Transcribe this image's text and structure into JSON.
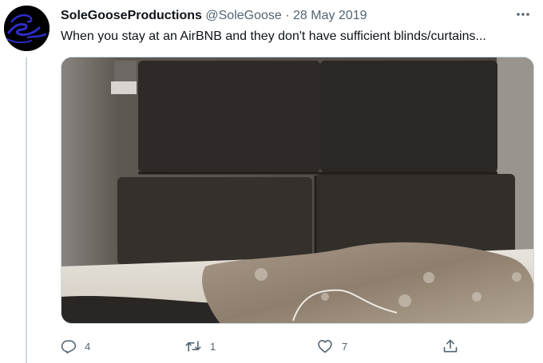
{
  "tweet": {
    "display_name": "SoleGooseProductions",
    "handle": "@SoleGoose",
    "separator": "·",
    "date": "28 May 2019",
    "text": "When you stay at an AirBNB and they don't have sufficient blinds/curtains..."
  },
  "icons": {
    "more": "more-horizontal-icon",
    "reply": "reply-icon",
    "retweet": "retweet-icon",
    "like": "heart-icon",
    "share": "share-icon",
    "avatar": "goose-logo"
  },
  "actions": {
    "reply_count": "4",
    "retweet_count": "1",
    "like_count": "7"
  },
  "colors": {
    "text_primary": "#0f1419",
    "text_secondary": "#536471",
    "border": "#cfd9de",
    "avatar_accent": "#2d2dc8"
  }
}
